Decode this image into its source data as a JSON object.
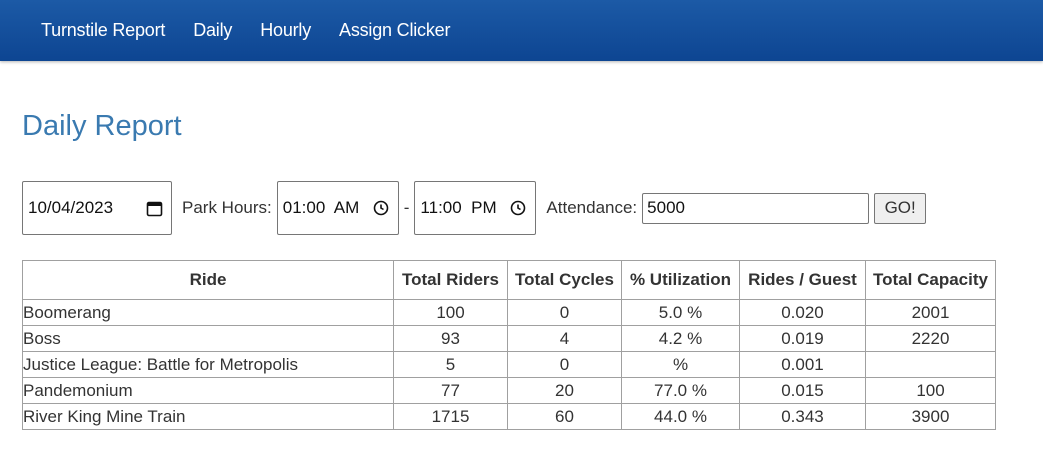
{
  "nav": {
    "items": [
      "Turnstile Report",
      "Daily",
      "Hourly",
      "Assign Clicker"
    ]
  },
  "page": {
    "title": "Daily Report"
  },
  "controls": {
    "date": "10/04/2023",
    "park_hours_label": "Park Hours:",
    "open_time": "01:00  AM",
    "separator": "-",
    "close_time": "11:00  PM",
    "attendance_label": "Attendance:",
    "attendance_value": "5000",
    "go_label": "GO!",
    "icons": {
      "date": "calendar-icon",
      "time": "clock-icon"
    }
  },
  "table": {
    "headers": [
      "Ride",
      "Total Riders",
      "Total Cycles",
      "% Utilization",
      "Rides / Guest",
      "Total Capacity"
    ],
    "rows": [
      [
        "Boomerang",
        "100",
        "0",
        "5.0 %",
        "0.020",
        "2001"
      ],
      [
        "Boss",
        "93",
        "4",
        "4.2 %",
        "0.019",
        "2220"
      ],
      [
        "Justice League: Battle for Metropolis",
        "5",
        "0",
        "%",
        "0.001",
        ""
      ],
      [
        "Pandemonium",
        "77",
        "20",
        "77.0 %",
        "0.015",
        "100"
      ],
      [
        "River King Mine Train",
        "1715",
        "60",
        "44.0 %",
        "0.343",
        "3900"
      ]
    ]
  },
  "colors": {
    "navbar": "#0d4592",
    "nav_text": "#ffffff",
    "title": "#3a7ab0",
    "border": "#a0a0a0"
  }
}
